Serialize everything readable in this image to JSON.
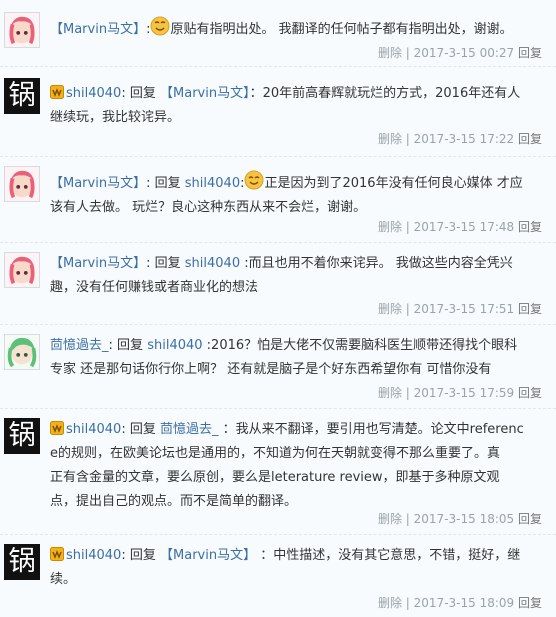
{
  "comments": [
    {
      "user": "【Marvin马文】",
      "sep": ":",
      "text_a": "原贴有指明出处。 我翻译的任何帖子都有指明出处，谢谢。",
      "delete": "删除",
      "time": "2017-3-15 00:27",
      "reply": "回复"
    },
    {
      "user": "shil4040",
      "reply_word": "回复",
      "target": "【Marvin马文】",
      "text_a": "：20年前高春辉就玩烂的方式，2016年还有人",
      "text_b": "继续玩，我比较诧异。",
      "delete": "删除",
      "time": "2017-3-15 17:22",
      "reply": "回复"
    },
    {
      "user": "【Marvin马文】",
      "reply_word": "回复",
      "target": "shil4040",
      "text_a": "正是因为到了2016年没有任何良心媒体 才应",
      "text_b": "该有人去做。 玩烂？良心这种东西从来不会烂，谢谢。",
      "delete": "删除",
      "time": "2017-3-15 17:48",
      "reply": "回复"
    },
    {
      "user": "【Marvin马文】",
      "reply_word": "回复",
      "target": "shil4040",
      "text_a": ":而且也用不着你来诧异。 我做这些内容全凭兴",
      "text_b": "趣，没有任何赚钱或者商业化的想法",
      "delete": "删除",
      "time": "2017-3-15 17:51",
      "reply": "回复"
    },
    {
      "user": "茴憶過去_",
      "reply_word": "回复",
      "target": "shil4040",
      "text_a": ":2016？怕是大佬不仅需要脑科医生顺带还得找个眼科",
      "text_b": "专家 还是那句话你行你上啊？ 还有就是脑子是个好东西希望你有 可惜你没有",
      "delete": "删除",
      "time": "2017-3-15 17:59",
      "reply": "回复"
    },
    {
      "user": "shil4040",
      "reply_word": "回复",
      "target": "茴憶過去_",
      "text_a": "：我从来不翻译，要引用也写清楚。论文中referenc",
      "text_b": "e的规则，在欧美论坛也是通用的，不知道为何在天朝就变得不那么重要了。真",
      "text_c": "正有含金量的文章，要么原创，要么是leterature review，即基于多种原文观",
      "text_d": "点，提出自己的观点。而不是简单的翻译。",
      "delete": "删除",
      "time": "2017-3-15 18:05",
      "reply": "回复"
    },
    {
      "user": "shil4040",
      "reply_word": "回复",
      "target": "【Marvin马文】",
      "text_a": "：中性描述，没有其它意思，不错，挺好，继",
      "text_b": "续。",
      "delete": "删除",
      "time": "2017-3-15 18:09",
      "reply": "回复"
    }
  ],
  "avatar_char": "锅",
  "separators": {
    "colon": ":",
    "pipe": " | "
  },
  "colors": {
    "link": "#3b6ea5",
    "meta": "#9aa3a9",
    "background": "#f7fbfd"
  }
}
